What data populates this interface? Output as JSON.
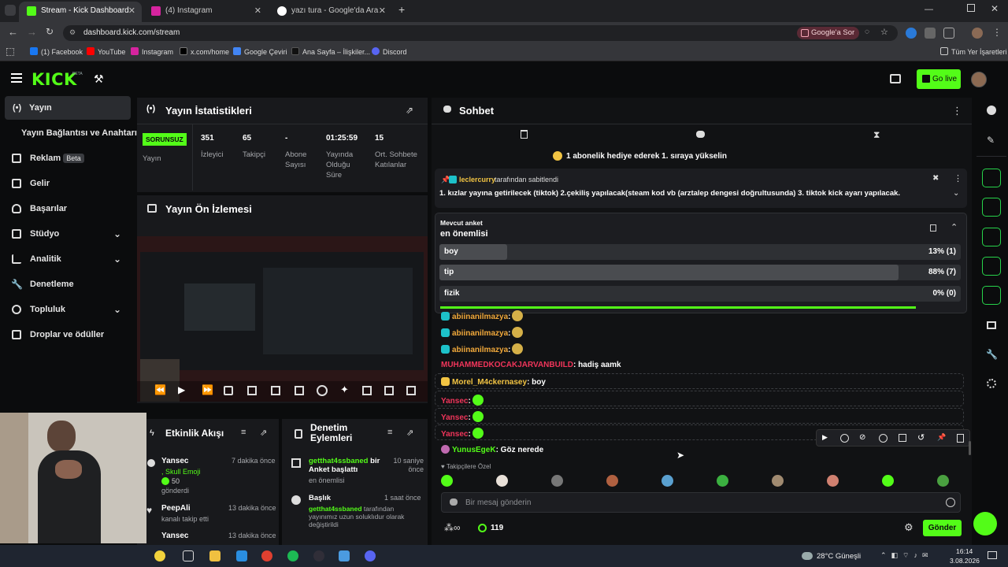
{
  "browser": {
    "tabs": [
      {
        "title": "Stream - Kick Dashboard"
      },
      {
        "title": "(4) Instagram"
      },
      {
        "title": "yazı tura - Google'da Ara"
      }
    ],
    "url": "dashboard.kick.com/stream",
    "google_ask": "Google'a Sor",
    "bookmarks": [
      "(1) Facebook",
      "YouTube",
      "Instagram",
      "x.com/home",
      "Google Çeviri",
      "Ana Sayfa – İlişkiler...",
      "Discord"
    ],
    "all_bookmarks": "Tüm Yer İşaretleri"
  },
  "header": {
    "logo": "KICK",
    "beta": "BETA",
    "go_live": "Go live"
  },
  "sidebar": {
    "items": [
      {
        "label": "Yayın"
      },
      {
        "label": "Yayın Bağlantısı ve Anahtarı"
      },
      {
        "label": "Reklam",
        "badge": "Beta"
      },
      {
        "label": "Gelir"
      },
      {
        "label": "Başarılar"
      },
      {
        "label": "Stüdyo"
      },
      {
        "label": "Analitik"
      },
      {
        "label": "Denetleme"
      },
      {
        "label": "Topluluk"
      },
      {
        "label": "Droplar ve ödüller"
      }
    ]
  },
  "stats": {
    "title": "Yayın İstatistikleri",
    "status": "SORUNSUZ",
    "status_label": "Yayın",
    "viewers": "351",
    "viewers_label": "İzleyici",
    "followers": "65",
    "followers_label": "Takipçi",
    "subs": "-",
    "subs_label": "Abone Sayısı",
    "uptime": "01:25:59",
    "uptime_label": "Yayında Olduğu Süre",
    "chatters": "15",
    "chatters_label": "Ort. Sohbete Katılanlar"
  },
  "preview": {
    "title": "Yayın Ön İzlemesi"
  },
  "activity": {
    "title": "Etkinlik Akışı",
    "items": [
      {
        "user": "Yansec",
        "time": "7 dakika önce",
        "detail": ", Skull Emoji",
        "amount": "50",
        "detail2": "gönderdi"
      },
      {
        "user": "PeepAli",
        "time": "13 dakika önce",
        "detail": "kanalı takip etti"
      },
      {
        "user": "Yansec",
        "time": "13 dakika önce"
      }
    ]
  },
  "moderation": {
    "title": "Denetim Eylemleri",
    "items": [
      {
        "user": "getthat4ssbaned",
        "action": "bir Anket başlattı",
        "time": "10 saniye önce",
        "detail": "en önemlisi"
      },
      {
        "title": "Başlık",
        "time": "1 saat önce",
        "user": "getthat4ssbaned",
        "detail": "tarafından yayınımız uzun soluklıdur olarak değiştirildi"
      }
    ]
  },
  "chat": {
    "title": "Sohbet",
    "sub_gift_banner": "1 abonelik hediye ederek 1. sıraya yükselin",
    "pinned_by": "leclercurry",
    "pinned_suffix": "tarafından sabitlendi",
    "pinned_text": "1. kızlar yayına getirilecek (tiktok) 2.çekiliş yapılacak(steam kod vb (arztalep dengesi doğrultusunda) 3. tiktok kick ayarı yapılacak.",
    "poll": {
      "label": "Mevcut anket",
      "question": "en önemlisi",
      "options": [
        {
          "text": "boy",
          "result": "13% (1)",
          "fraction": 0.13
        },
        {
          "text": "tip",
          "result": "88% (7)",
          "fraction": 0.88
        },
        {
          "text": "fizik",
          "result": "0% (0)",
          "fraction": 0.0
        }
      ],
      "time_remaining_fraction": 0.91
    },
    "messages": [
      {
        "user": "abiinanilmazya",
        "text": ""
      },
      {
        "user": "abiinanilmazya",
        "text": ""
      },
      {
        "user": "abiinanilmazya",
        "text": ""
      },
      {
        "user": "MUHAMMEDKOCAKJARVANBUILD",
        "text": ": hadiş aamk"
      },
      {
        "user": "Morel_M4ckernasey",
        "text": ": boy"
      },
      {
        "user": "Yansec",
        "text": ":"
      },
      {
        "user": "Yansec",
        "text": ":"
      },
      {
        "user": "Yansec",
        "text": ":"
      },
      {
        "user": "YunusEgeK",
        "text": ": Göz nerede"
      }
    ],
    "emote_label": "Takipçilere Özel",
    "input_placeholder": "Bir mesaj gönderin",
    "points": "119",
    "send": "Gönder"
  },
  "taskbar": {
    "weather": "28°C  Güneşli",
    "time": "16:14",
    "date": "3.08.2026"
  },
  "colors": {
    "kick_green": "#53fc18",
    "panel": "#18191c",
    "bg": "#0b0c0d"
  }
}
